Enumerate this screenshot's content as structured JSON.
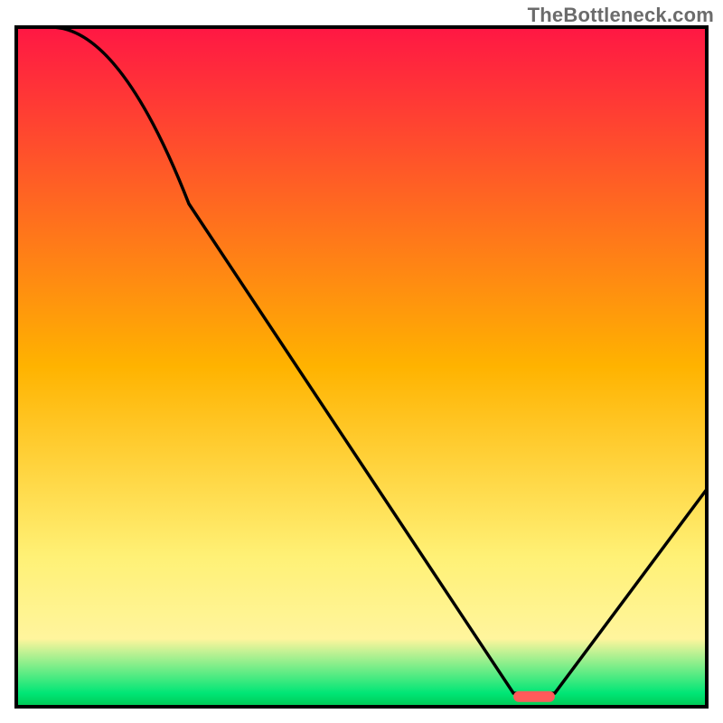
{
  "watermark": "TheBottleneck.com",
  "chart_data": {
    "type": "line",
    "title": "",
    "xlabel": "",
    "ylabel": "",
    "xlim": [
      0,
      100
    ],
    "ylim": [
      0,
      100
    ],
    "grid": false,
    "legend": false,
    "background_gradient": {
      "stops": [
        {
          "offset": 0.0,
          "color": "#ff1744"
        },
        {
          "offset": 0.5,
          "color": "#ffb300"
        },
        {
          "offset": 0.78,
          "color": "#fff176"
        },
        {
          "offset": 0.9,
          "color": "#fff59d"
        },
        {
          "offset": 0.98,
          "color": "#00e676"
        },
        {
          "offset": 1.0,
          "color": "#00c853"
        }
      ]
    },
    "curve": {
      "name": "bottleneck-curve",
      "color": "#000000",
      "points_xy": [
        [
          5,
          100
        ],
        [
          25,
          74
        ],
        [
          72,
          2
        ],
        [
          78,
          2
        ],
        [
          100,
          32
        ]
      ]
    },
    "marker": {
      "name": "optimal-marker",
      "color": "#ff5a5a",
      "x_range": [
        72,
        78
      ],
      "y": 1.5
    }
  }
}
